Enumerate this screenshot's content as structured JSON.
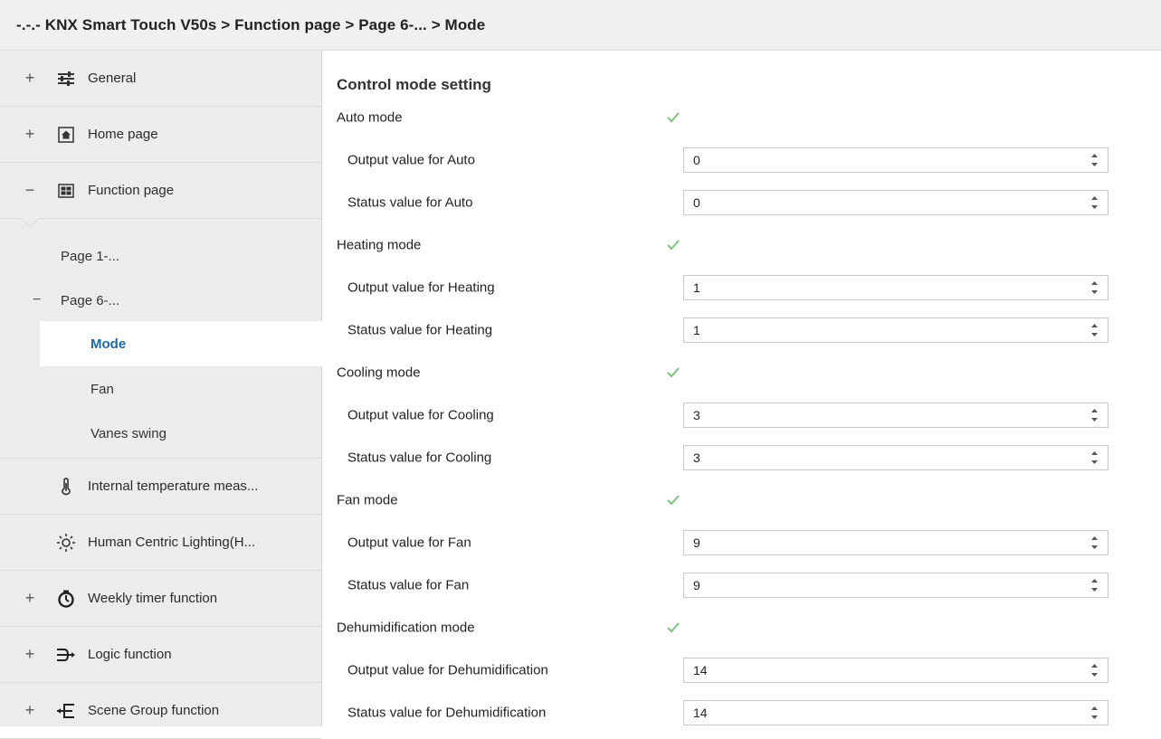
{
  "window": {
    "breadcrumb": "-.-.- KNX Smart Touch V50s > Function page > Page 6-... > Mode"
  },
  "sidebar": {
    "top_items": [
      {
        "toggle": "+",
        "icon": "sliders-icon",
        "label": "General"
      },
      {
        "toggle": "+",
        "icon": "home-icon",
        "label": "Home page"
      },
      {
        "toggle": "−",
        "icon": "grid-icon",
        "label": "Function page"
      }
    ],
    "sub_items": [
      {
        "label": "Page 1-..."
      },
      {
        "toggle": "−",
        "label": "Page 6-..."
      },
      {
        "label": "Mode",
        "selected": true
      },
      {
        "label": "Fan"
      },
      {
        "label": "Vanes swing"
      }
    ],
    "bottom_items": [
      {
        "toggle": "",
        "icon": "thermometer-icon",
        "label": "Internal temperature meas..."
      },
      {
        "toggle": "",
        "icon": "sun-icon",
        "label": "Human Centric Lighting(H..."
      },
      {
        "toggle": "+",
        "icon": "timer-icon",
        "label": "Weekly timer function"
      },
      {
        "toggle": "+",
        "icon": "logic-icon",
        "label": "Logic function"
      },
      {
        "toggle": "+",
        "icon": "scene-icon",
        "label": "Scene Group function"
      }
    ]
  },
  "main": {
    "section_title": "Control mode setting",
    "modes": [
      {
        "label": "Auto mode",
        "checked": true,
        "output_label": "Output value for Auto",
        "output_value": "0",
        "status_label": "Status value for Auto",
        "status_value": "0"
      },
      {
        "label": "Heating mode",
        "checked": true,
        "output_label": "Output value for Heating",
        "output_value": "1",
        "status_label": "Status value for Heating",
        "status_value": "1"
      },
      {
        "label": "Cooling mode",
        "checked": true,
        "output_label": "Output value for Cooling",
        "output_value": "3",
        "status_label": "Status value for Cooling",
        "status_value": "3"
      },
      {
        "label": "Fan mode",
        "checked": true,
        "output_label": "Output value for Fan",
        "output_value": "9",
        "status_label": "Status value for Fan",
        "status_value": "9"
      },
      {
        "label": "Dehumidification mode",
        "checked": true,
        "output_label": "Output value for Dehumidification",
        "output_value": "14",
        "status_label": "Status value for Dehumidification",
        "status_value": "14"
      }
    ]
  },
  "colors": {
    "check": "#7cc47c",
    "selected_text": "#1e6aa8",
    "sidebar_bg": "#ececec"
  }
}
